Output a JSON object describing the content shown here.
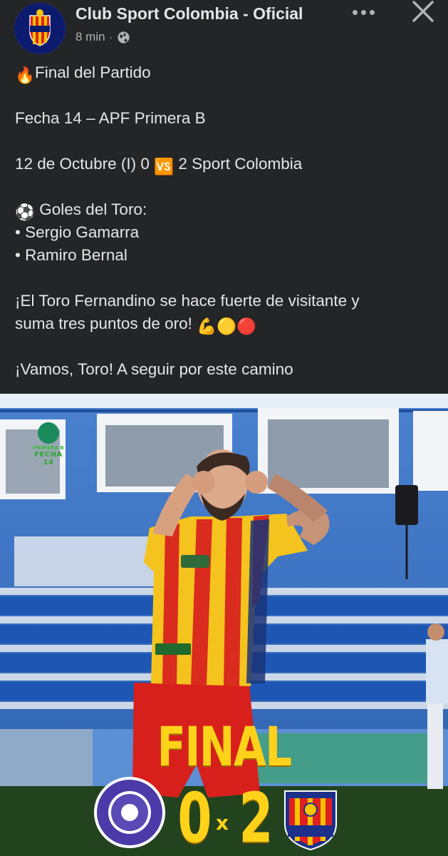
{
  "post": {
    "page_name": "Club Sport Colombia - Oficial",
    "time_ago": "8 min",
    "separator": "·",
    "avatar_icon": "club-sport-colombia-crest",
    "privacy_icon": "globe-icon",
    "more_icon": "more-dots-icon",
    "close_icon": "close-icon"
  },
  "body": {
    "title_emoji": "🔥",
    "title": "Final del Partido",
    "fixture": "Fecha 14 – APF Primera B",
    "result_left": "12 de Octubre (I) 0",
    "result_vs": "🆚",
    "result_right": "2 Sport Colombia",
    "goals_emoji": "⚽",
    "goals_header": "Goles del Toro:",
    "scorers": [
      "• Sergio Gamarra",
      "• Ramiro Bernal"
    ],
    "message_line1": "¡El Toro Fernandino se hace fuerte de visitante y",
    "message_line2": "suma tres puntos de oro!",
    "message_emojis": "💪🟡🔴",
    "closing": "¡Vamos, Toro! A seguir por este camino"
  },
  "photo": {
    "badge_top": "PRIMERA B",
    "badge_fecha": "FECHA 14",
    "final_label": "FINAL",
    "home_score": "0",
    "score_separator": "x",
    "away_score": "2",
    "home_crest_icon": "club-12-de-octubre-crest",
    "away_crest_icon": "club-sport-colombia-crest",
    "colors": {
      "score_yellow": "#ffd21a",
      "stadium_blue": "#3a6fc0",
      "pitch_green": "#2f5a2a"
    }
  }
}
